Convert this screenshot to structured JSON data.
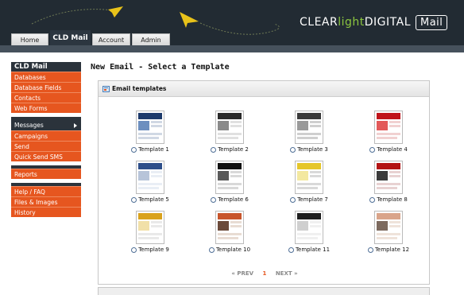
{
  "header": {
    "brand_clear": "CLEAR",
    "brand_light": "light",
    "brand_digital": "DIGITAL",
    "brand_mail": "Mail",
    "tabs": [
      {
        "label": "Home"
      },
      {
        "label": "CLD Mail"
      },
      {
        "label": "Account"
      },
      {
        "label": "Admin"
      }
    ],
    "active_tab": "CLD Mail"
  },
  "sidebar": {
    "section1_title": "CLD Mail",
    "section1_items": [
      {
        "label": "Databases"
      },
      {
        "label": "Database Fields"
      },
      {
        "label": "Contacts"
      },
      {
        "label": "Web Forms"
      }
    ],
    "messages_label": "Messages",
    "section2_items": [
      {
        "label": "Campaigns"
      },
      {
        "label": "Send"
      },
      {
        "label": "Quick Send SMS"
      }
    ],
    "reports_label": "Reports",
    "section3_items": [
      {
        "label": "Help / FAQ"
      },
      {
        "label": "Files & Images"
      },
      {
        "label": "History"
      }
    ]
  },
  "main": {
    "title": "New Email - Select a Template",
    "panel_title": "Email templates",
    "templates": [
      {
        "label": "Template 1"
      },
      {
        "label": "Template 2"
      },
      {
        "label": "Template 3"
      },
      {
        "label": "Template 4"
      },
      {
        "label": "Template 5"
      },
      {
        "label": "Template 6"
      },
      {
        "label": "Template 7"
      },
      {
        "label": "Template 8"
      },
      {
        "label": "Template 9"
      },
      {
        "label": "Template 10"
      },
      {
        "label": "Template 11"
      },
      {
        "label": "Template 12"
      }
    ],
    "pager": {
      "prev": "« PREV",
      "current": "1",
      "next": "NEXT »"
    }
  },
  "colors": {
    "accent": "#e6561f",
    "header": "#222b33",
    "brand_green": "#8cc63f"
  }
}
